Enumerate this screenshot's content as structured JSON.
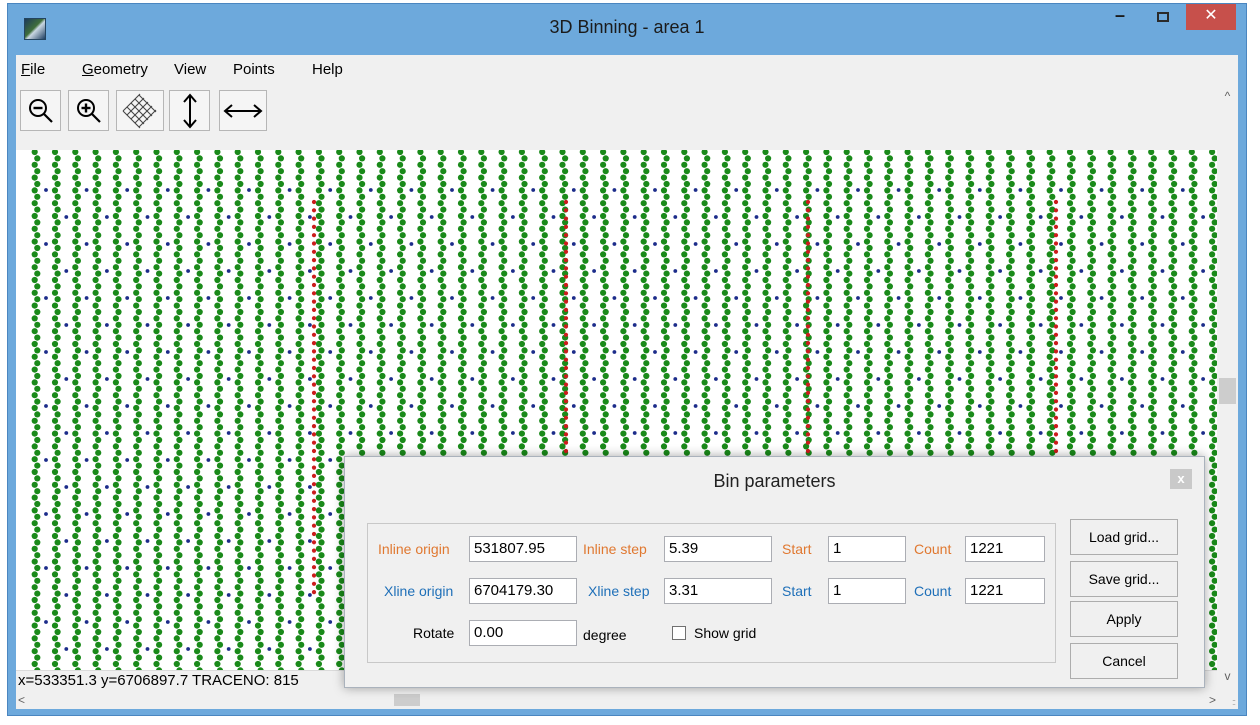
{
  "window": {
    "title": "3D Binning - area 1",
    "min_glyph": "–",
    "close_glyph": "✕"
  },
  "menu": [
    {
      "mnemonic": "F",
      "rest": "ile"
    },
    {
      "mnemonic": "G",
      "rest": "eometry"
    },
    {
      "label": "View"
    },
    {
      "label": "Points"
    },
    {
      "label": "Help"
    }
  ],
  "toolbar": {
    "buttons": [
      {
        "name": "zoom-out",
        "icon": "zoom-out-icon"
      },
      {
        "name": "zoom-in",
        "icon": "zoom-in-icon"
      },
      {
        "name": "grid",
        "icon": "grid-icon"
      },
      {
        "name": "vertical",
        "icon": "vertical-arrows-icon"
      },
      {
        "name": "horizontal",
        "icon": "horizontal-arrows-icon"
      }
    ]
  },
  "canvas": {
    "colors": {
      "trace": "#1a8a1a",
      "receiver": "#1c2c8a",
      "source": "#cc1c1c"
    }
  },
  "status": {
    "text": "x=533351.3 y=6706897.7 TRACENO: 815"
  },
  "scroll": {
    "up": "^",
    "down": "v",
    "left": "<",
    "right": ">",
    "grip": "::"
  },
  "dialog": {
    "title": "Bin parameters",
    "close_glyph": "x",
    "inline_origin_label": "Inline origin",
    "inline_origin": "531807.95",
    "inline_step_label": "Inline step",
    "inline_step": "5.39",
    "inline_start_label": "Start",
    "inline_start": "1",
    "inline_count_label": "Count",
    "inline_count": "1221",
    "xline_origin_label": "Xline origin",
    "xline_origin": "6704179.30",
    "xline_step_label": "Xline step",
    "xline_step": "3.31",
    "xline_start_label": "Start",
    "xline_start": "1",
    "xline_count_label": "Count",
    "xline_count": "1221",
    "rotate_label": "Rotate",
    "rotate": "0.00",
    "degree_label": "degree",
    "show_grid_label": "Show grid",
    "show_grid_checked": false,
    "load_grid": "Load grid...",
    "save_grid": "Save grid...",
    "apply": "Apply",
    "cancel": "Cancel"
  }
}
